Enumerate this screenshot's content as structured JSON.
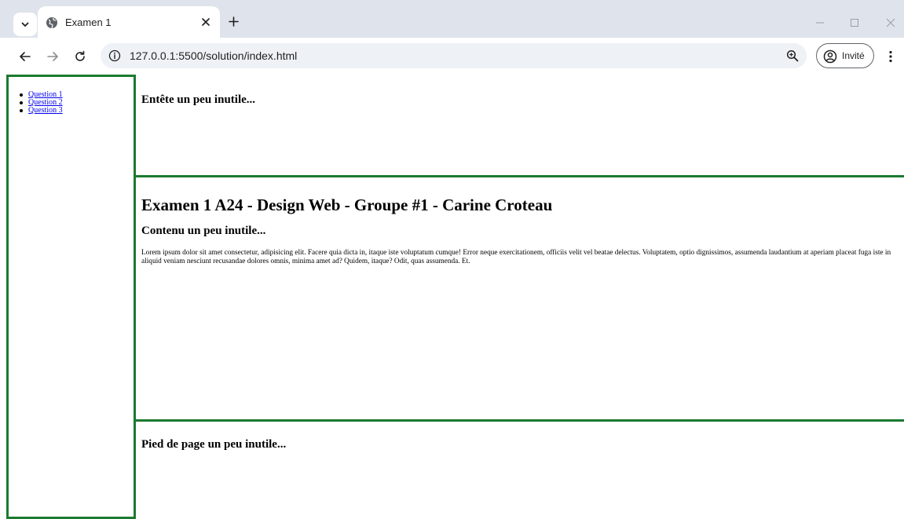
{
  "browser": {
    "tab": {
      "title": "Examen 1"
    },
    "url": "127.0.0.1:5500/solution/index.html",
    "profile_label": "Invité",
    "icons": {
      "tab_search": "chevron-down-icon",
      "tab_favicon": "globe-icon",
      "tab_close": "close-icon",
      "new_tab": "plus-icon",
      "back": "arrow-left-icon",
      "forward": "arrow-right-icon",
      "reload": "reload-icon",
      "site_info": "info-icon",
      "zoom": "zoom-icon",
      "profile": "profile-icon",
      "menu": "kebab-menu-icon"
    }
  },
  "page": {
    "nav": {
      "items": [
        {
          "label": "Question 1"
        },
        {
          "label": "Question 2"
        },
        {
          "label": "Question 3"
        }
      ]
    },
    "header": {
      "text": "Entête un peu inutile..."
    },
    "main": {
      "title": "Examen 1 A24 - Design Web - Groupe #1 - Carine Croteau",
      "subtitle": "Contenu un peu inutile...",
      "body": "Lorem ipsum dolor sit amet consectetur, adipisicing elit. Facere quia dicta in, itaque iste voluptatum cumque! Error neque exercitationem, officiis velit vel beatae delectus. Voluptatem, optio dignissimos, assumenda laudantium at aperiam placeat fuga iste in aliquid veniam nesciunt recusandae dolores omnis, minima amet ad? Quidem, itaque? Odit, quas assumenda. Et."
    },
    "footer": {
      "text": "Pied de page un peu inutile..."
    },
    "colors": {
      "border": "#1b7a2f",
      "link": "#0000ee"
    }
  }
}
